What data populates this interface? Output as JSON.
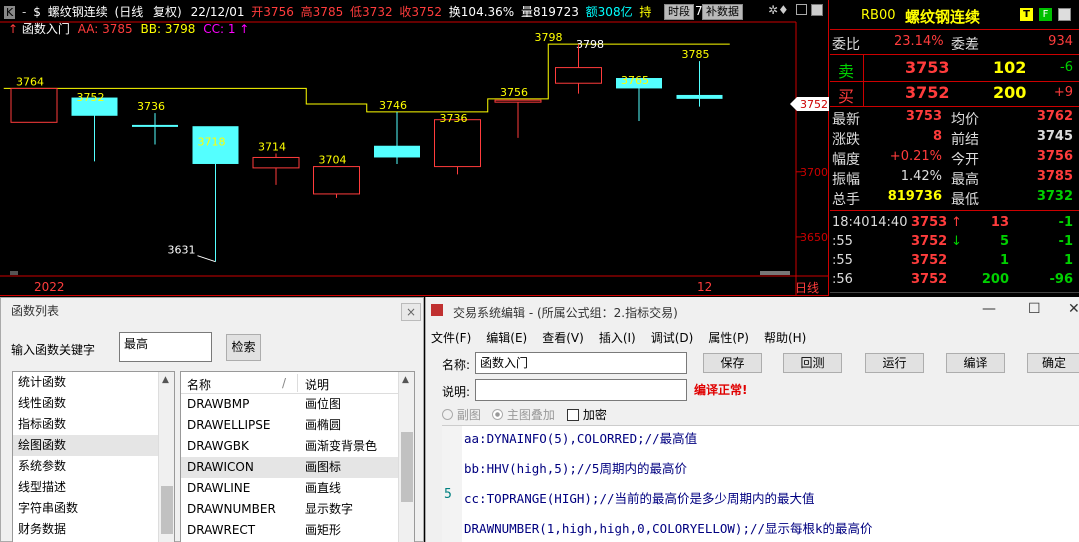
{
  "chart_header": {
    "k_box": "K",
    "arrow": "-",
    "dollar": "$",
    "name": "螺纹钢连续",
    "period": "(日线",
    "fuquan": "复权)",
    "date": "22/12/01",
    "open": "开3756",
    "high": "高3785",
    "low": "低3732",
    "close": "收3752",
    "turnover": "换104.36%",
    "volume": "量819723",
    "amount": "额308亿",
    "hold": "持",
    "hold_tail": "7",
    "btn_period": "时段",
    "btn_data": "补数据",
    "icons": "✲♦"
  },
  "indicator_line": {
    "arrow": "↑",
    "name": "函数入门",
    "aa": "AA: 3785",
    "bb": "BB: 3798",
    "cc": "CC: 1",
    "cc_arrow": "↑"
  },
  "axis": {
    "price_ticks": [
      "3750",
      "3700",
      "3650"
    ],
    "current_price": "3752",
    "x_labels": [
      "2022",
      "12"
    ],
    "bottom_right": "日线"
  },
  "chart_data": {
    "type": "candlestick",
    "candles": [
      {
        "open": 3738,
        "close": 3764,
        "high": 3764,
        "low": 3738,
        "label": "3764",
        "color": "red"
      },
      {
        "open": 3757,
        "close": 3743,
        "high": 3752,
        "low": 3708,
        "label": "3752",
        "color": "cyan"
      },
      {
        "open": 3736,
        "close": 3735,
        "high": 3745,
        "low": 3721,
        "label": "3736",
        "color": "cyan"
      },
      {
        "open": 3735,
        "close": 3706,
        "high": 3718,
        "low": 3631,
        "label": "3718",
        "color": "cyan",
        "low_label": "3631"
      },
      {
        "open": 3703,
        "close": 3711,
        "high": 3714,
        "low": 3690,
        "label": "3714",
        "color": "red"
      },
      {
        "open": 3683,
        "close": 3704,
        "high": 3704,
        "low": 3680,
        "label": "3704",
        "color": "red"
      },
      {
        "open": 3711,
        "close": 3720,
        "high": 3746,
        "low": 3706,
        "label": "3746",
        "color": "cyan"
      },
      {
        "open": 3704,
        "close": 3740,
        "high": 3736,
        "low": 3698,
        "label": "3736",
        "color": "red"
      },
      {
        "open": 3754,
        "close": 3755,
        "high": 3756,
        "low": 3726,
        "label": "3756",
        "color": "red"
      },
      {
        "open": 3768,
        "close": 3780,
        "high": 3798,
        "low": 3760,
        "label": "3798",
        "color": "red"
      },
      {
        "open": 3772,
        "close": 3764,
        "high": 3765,
        "low": 3739,
        "label": "3765",
        "color": "cyan"
      },
      {
        "open": 3759,
        "close": 3756,
        "high": 3785,
        "low": 3750,
        "label": "3785",
        "color": "cyan"
      }
    ],
    "hhv_line_label": "3798",
    "ylim": [
      3620,
      3815
    ]
  },
  "quote": {
    "code": "RB00",
    "name": "螺纹钢连续",
    "btn_t": "T",
    "btn_f": "F",
    "weibi_label": "委比",
    "weibi": "23.14%",
    "weicha_label": "委差",
    "weicha": "934",
    "sell_label": "卖",
    "sell_price": "3753",
    "sell_vol": "102",
    "sell_chg": "-6",
    "buy_label": "买",
    "buy_price": "3752",
    "buy_vol": "200",
    "buy_chg": "+9",
    "rows": [
      {
        "l1": "最新",
        "v1": "3753",
        "l2": "均价",
        "v2": "3762"
      },
      {
        "l1": "涨跌",
        "v1": "8",
        "l2": "前结",
        "v2": "3745"
      },
      {
        "l1": "幅度",
        "v1": "+0.21%",
        "l2": "今开",
        "v2": "3756"
      },
      {
        "l1": "振幅",
        "v1": "1.42%",
        "l2": "最高",
        "v2": "3785"
      },
      {
        "l1": "总手",
        "v1": "819736",
        "l2": "最低",
        "v2": "3732"
      }
    ],
    "ticks": [
      {
        "t1": "18:40",
        "t2": "14:40",
        "price": "3753",
        "arrow": "↑",
        "vol": "13",
        "chg": "-1"
      },
      {
        "t1": ":55",
        "t2": "",
        "price": "3752",
        "arrow": "↓",
        "vol": "5",
        "chg": "-1"
      },
      {
        "t1": ":55",
        "t2": "",
        "price": "3752",
        "arrow": "",
        "vol": "1",
        "chg": "1"
      },
      {
        "t1": ":56",
        "t2": "",
        "price": "3752",
        "arrow": "",
        "vol": "200",
        "chg": "-96"
      }
    ]
  },
  "func_window": {
    "title": "函数列表",
    "close": "×",
    "keyword_label": "输入函数关键字",
    "keyword_value": "最高",
    "search_btn": "检索",
    "categories": [
      "统计函数",
      "线性函数",
      "指标函数",
      "绘图函数",
      "系统参数",
      "线型描述",
      "字符串函数",
      "财务数据"
    ],
    "col_name": "名称",
    "col_sort": "/",
    "col_desc": "说明",
    "funcs": [
      {
        "name": "DRAWBMP",
        "desc": "画位图"
      },
      {
        "name": "DRAWELLIPSE",
        "desc": "画椭圆"
      },
      {
        "name": "DRAWGBK",
        "desc": "画渐变背景色"
      },
      {
        "name": "DRAWICON",
        "desc": "画图标"
      },
      {
        "name": "DRAWLINE",
        "desc": "画直线"
      },
      {
        "name": "DRAWNUMBER",
        "desc": "显示数字"
      },
      {
        "name": "DRAWRECT",
        "desc": "画矩形"
      }
    ]
  },
  "edit_window": {
    "title": "交易系统编辑 - (所属公式组：2.指标交易)",
    "minimize": "—",
    "maximize": "☐",
    "close": "✕",
    "menus": [
      "文件(F)",
      "编辑(E)",
      "查看(V)",
      "插入(I)",
      "调试(D)",
      "属性(P)",
      "帮助(H)"
    ],
    "name_label": "名称:",
    "name_value": "函数入门",
    "desc_label": "说明:",
    "desc_value": "",
    "buttons": [
      "保存",
      "回测",
      "运行",
      "编译",
      "确定"
    ],
    "status": "编译正常!",
    "radio_sub": "副图",
    "radio_main": "主图叠加",
    "check_encrypt": "加密",
    "code_lines": [
      "aa:DYNAINFO(5),COLORRED;//最高值",
      "bb:HHV(high,5);//5周期内的最高价",
      "cc:TOPRANGE(HIGH);//当前的最高价是多少周期内的最大值",
      "DRAWNUMBER(1,high,high,0,COLORYELLOW);//显示每根k的最高价"
    ],
    "line_number": "5"
  }
}
